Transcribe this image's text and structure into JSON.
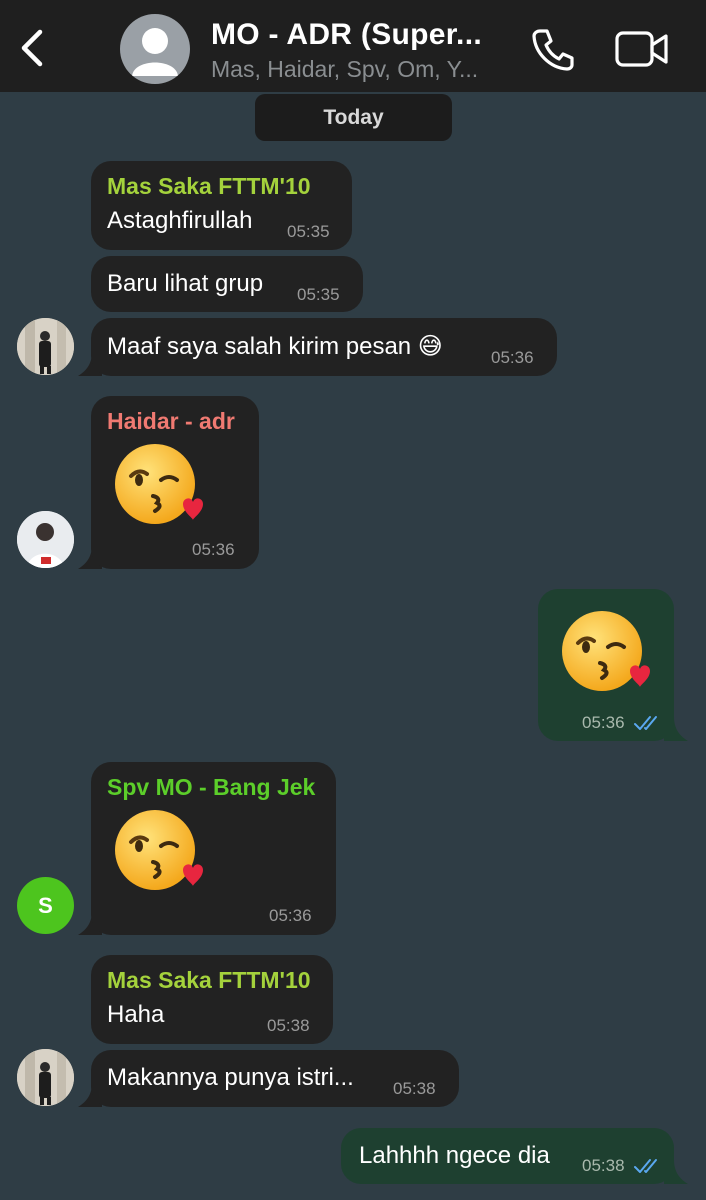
{
  "header": {
    "title": "MO - ADR (Super...",
    "subtitle": "Mas, Haidar, Spv, Om, Y...",
    "back_icon": "chevron-left-icon",
    "call_icon": "phone-icon",
    "video_icon": "video-camera-icon"
  },
  "date_chip": "Today",
  "colors": {
    "background": "#2f3d45",
    "header": "#1f1f1f",
    "incoming_bubble": "#222222",
    "outgoing_bubble": "#1e4030",
    "sender_green": "#a4d23c",
    "sender_red": "#f07a72",
    "sender_green2": "#5cce2a",
    "tick_blue": "#5aa8f0"
  },
  "messages": [
    {
      "sender": "Mas Saka FTTM'10",
      "text": "Astaghfirullah",
      "time": "05:35"
    },
    {
      "text": "Baru lihat grup",
      "time": "05:35"
    },
    {
      "text": "Maaf saya salah kirim pesan 😅",
      "time": "05:36"
    },
    {
      "sender": "Haidar - adr",
      "emoji": "face-blowing-kiss",
      "time": "05:36"
    },
    {
      "outgoing": true,
      "emoji": "face-blowing-kiss",
      "time": "05:36",
      "status": "read"
    },
    {
      "sender": "Spv MO - Bang Jek",
      "emoji": "face-blowing-kiss",
      "time": "05:36",
      "avatar_letter": "S"
    },
    {
      "sender": "Mas Saka FTTM'10",
      "text": "Haha",
      "time": "05:38"
    },
    {
      "text": "Makannya punya istri...",
      "time": "05:38"
    },
    {
      "outgoing": true,
      "text": "Lahhhh ngece dia",
      "time": "05:38",
      "status": "read"
    }
  ]
}
